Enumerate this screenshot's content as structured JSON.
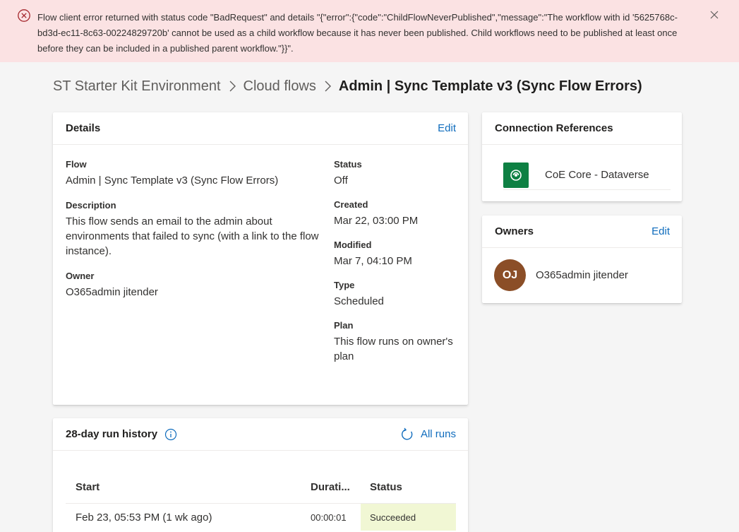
{
  "error": {
    "message": "Flow client error returned with status code \"BadRequest\" and details \"{\"error\":{\"code\":\"ChildFlowNeverPublished\",\"message\":\"The workflow with id '5625768c-bd3d-ec11-8c63-00224829720b' cannot be used as a child workflow because it has never been published. Child workflows need to be published at least once before they can be included in a published parent workflow.\"}}\".",
    "icon": "error-circle-icon",
    "close_icon": "close-icon"
  },
  "breadcrumb": {
    "environment": "ST Starter Kit Environment",
    "section": "Cloud flows",
    "current": "Admin | Sync Template v3 (Sync Flow Errors)"
  },
  "details": {
    "title": "Details",
    "edit_label": "Edit",
    "flow_label": "Flow",
    "flow_value": "Admin | Sync Template v3 (Sync Flow Errors)",
    "description_label": "Description",
    "description_value": "This flow sends an email to the admin about environments that failed to sync (with a link to the flow instance).",
    "owner_label": "Owner",
    "owner_value": "O365admin jitender",
    "status_label": "Status",
    "status_value": "Off",
    "created_label": "Created",
    "created_value": "Mar 22, 03:00 PM",
    "modified_label": "Modified",
    "modified_value": "Mar 7, 04:10 PM",
    "type_label": "Type",
    "type_value": "Scheduled",
    "plan_label": "Plan",
    "plan_value": "This flow runs on owner's plan"
  },
  "connections": {
    "title": "Connection References",
    "items": [
      {
        "name": "CoE Core - Dataverse",
        "icon": "dataverse-icon"
      }
    ]
  },
  "owners": {
    "title": "Owners",
    "edit_label": "Edit",
    "items": [
      {
        "initials": "OJ",
        "name": "O365admin jitender"
      }
    ]
  },
  "run_history": {
    "title": "28-day run history",
    "all_runs_label": "All runs",
    "columns": [
      "Start",
      "Durati...",
      "Status"
    ],
    "rows": [
      {
        "start": "Feb 23, 05:53 PM (1 wk ago)",
        "duration": "00:00:01",
        "status": "Succeeded"
      }
    ]
  },
  "colors": {
    "accent": "#0f6cbd",
    "error_bg": "#fbe2e3",
    "error_icon": "#a4262c",
    "avatar_bg": "#8b4e27",
    "dataverse_bg": "#0e8043",
    "succeeded_bg": "#f1f7d4"
  }
}
